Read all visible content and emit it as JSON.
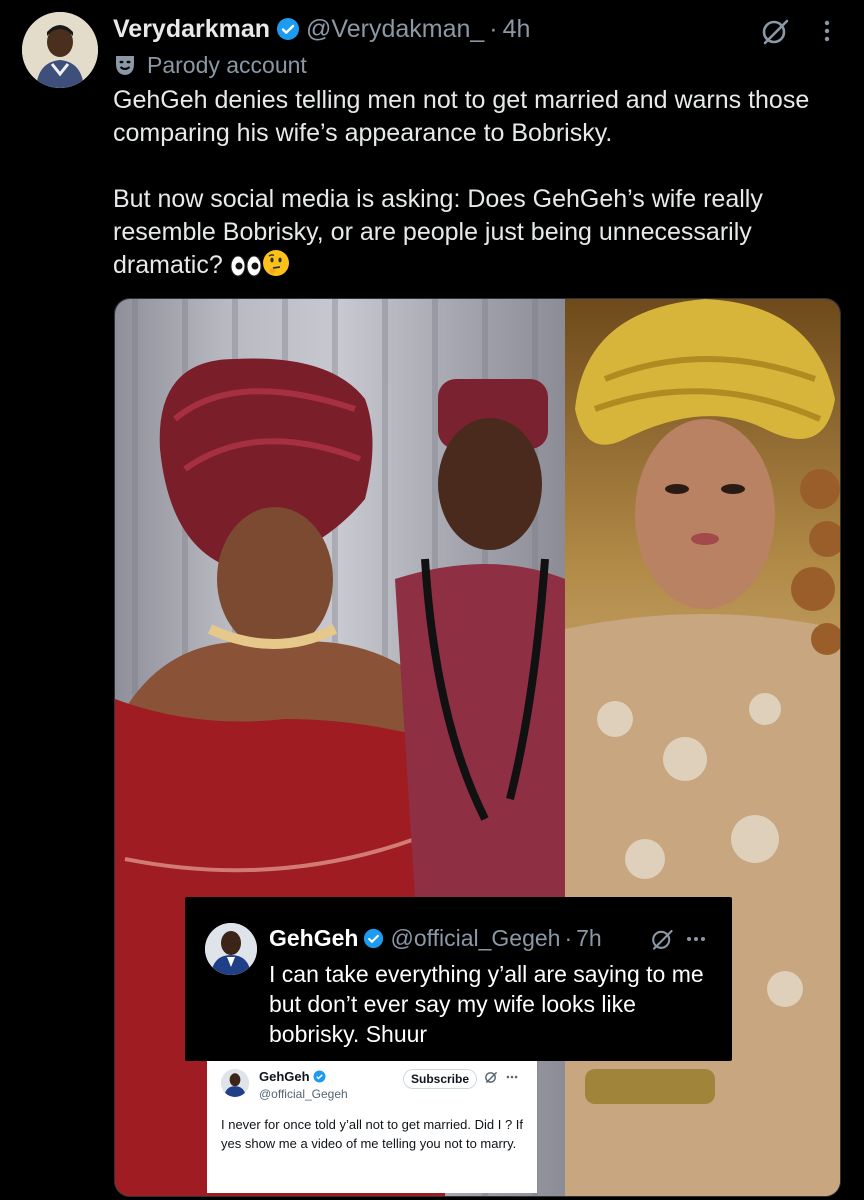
{
  "post": {
    "display_name": "Verydarkman",
    "handle": "@Verydakman_",
    "separator": "·",
    "time": "4h",
    "label": "Parody account",
    "text_line1": "GehGeh denies telling men not to get married and warns those comparing his wife’s appearance to Bobrisky.",
    "text_line2": "But now social media is asking: Does GehGeh’s wife really resemble Bobrisky, or are people just being unnecessarily dramatic?",
    "emojis": [
      "eyes-emoji",
      "thinking-face-emoji"
    ],
    "colors": {
      "background": "#000000",
      "text": "#e7e9ea",
      "secondary": "#8b98a5",
      "verified": "#1d9bf0"
    }
  },
  "embedded_tweet": {
    "display_name": "GehGeh",
    "handle": "@official_Gegeh",
    "separator": "·",
    "time": "7h",
    "text": "I can take everything y’all are saying to me but don’t ever say my wife looks like bobrisky. Shuur"
  },
  "embedded_tweet_2": {
    "display_name": "GehGeh",
    "handle": "@official_Gegeh",
    "subscribe_label": "Subscribe",
    "text": "I never for once told y’all not to get married. Did I ? If yes show me a video of me telling you not to marry."
  }
}
